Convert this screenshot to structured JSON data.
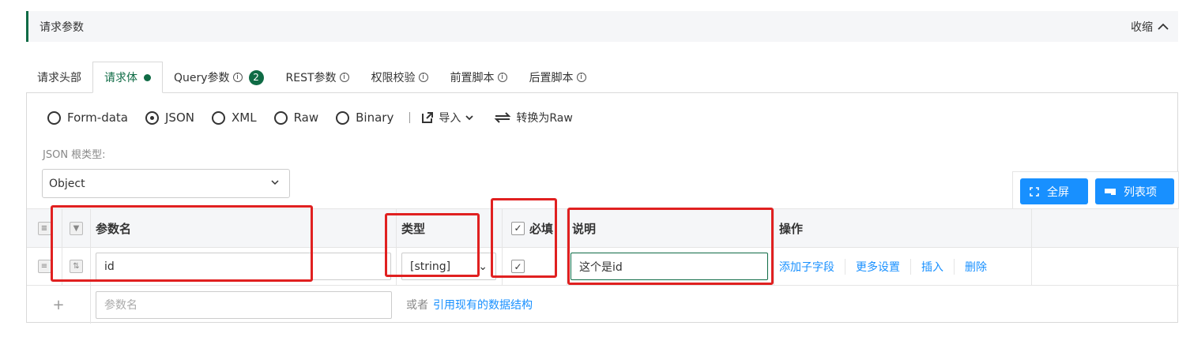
{
  "section": {
    "title": "请求参数",
    "collapse_label": "收缩"
  },
  "tabs": [
    {
      "label": "请求头部",
      "active": false
    },
    {
      "label": "请求体",
      "active": true
    },
    {
      "label": "Query参数",
      "badge": "2",
      "active": false
    },
    {
      "label": "REST参数",
      "active": false
    },
    {
      "label": "权限校验",
      "active": false
    },
    {
      "label": "前置脚本",
      "active": false
    },
    {
      "label": "后置脚本",
      "active": false
    }
  ],
  "body_types": [
    {
      "label": "Form-data",
      "selected": false
    },
    {
      "label": "JSON",
      "selected": true
    },
    {
      "label": "XML",
      "selected": false
    },
    {
      "label": "Raw",
      "selected": false
    },
    {
      "label": "Binary",
      "selected": false
    }
  ],
  "tools": {
    "import_label": "导入",
    "convert_label": "转换为Raw"
  },
  "root": {
    "label": "JSON 根类型:",
    "value": "Object"
  },
  "buttons": {
    "fullscreen": "全屏",
    "list": "列表项"
  },
  "table": {
    "headers": {
      "name": "参数名",
      "type": "类型",
      "required": "必填",
      "desc": "说明",
      "ops": "操作"
    },
    "rows": [
      {
        "name": "id",
        "type": "[string]",
        "required": true,
        "desc": "这个是id",
        "ops": [
          "添加子字段",
          "更多设置",
          "插入",
          "删除"
        ]
      }
    ],
    "new_row": {
      "placeholder": "参数名",
      "or_label": "或者",
      "ref_link": "引用现有的数据结构"
    }
  },
  "colors": {
    "accent": "#0f6b45",
    "primary": "#1890ff",
    "highlight": "#e02020"
  }
}
